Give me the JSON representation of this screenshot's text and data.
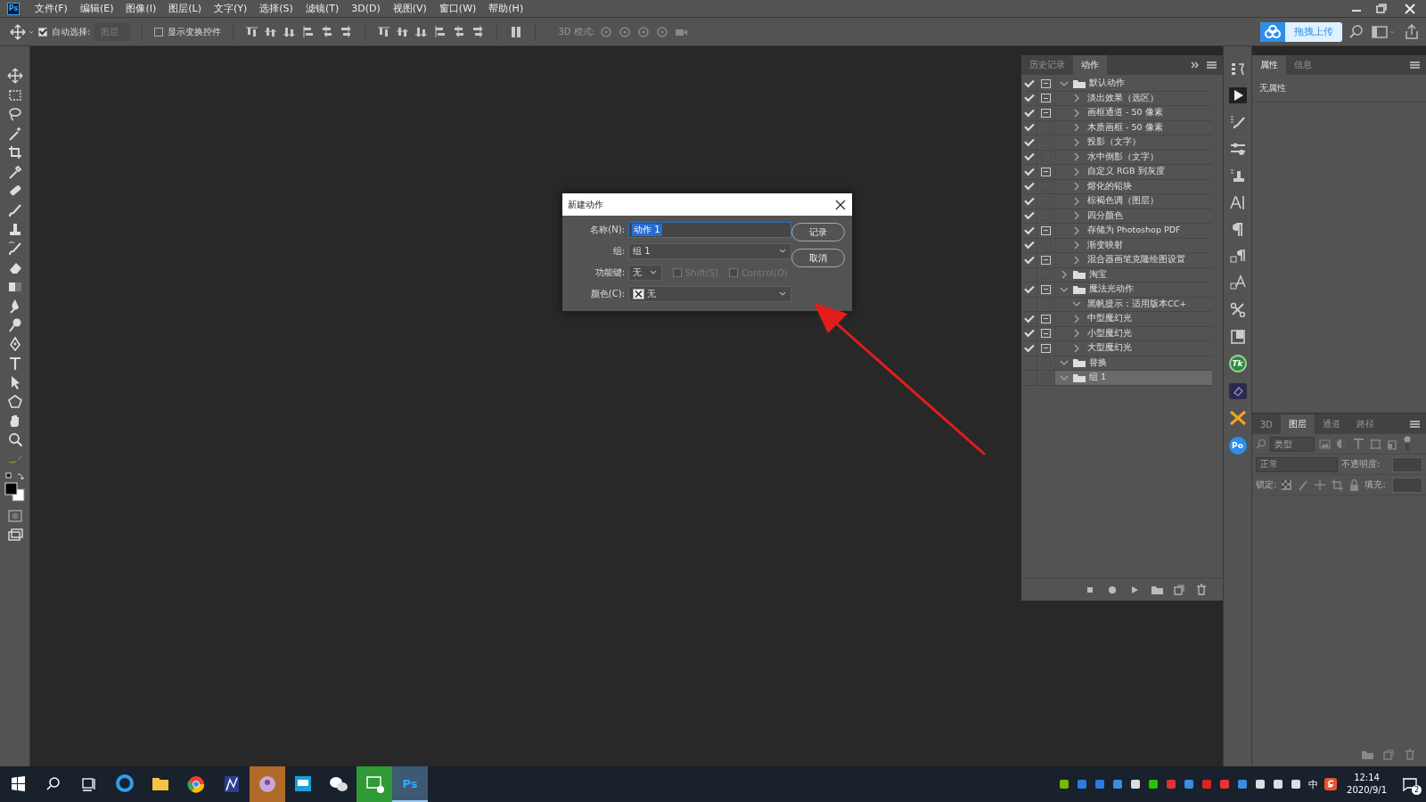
{
  "app_icon": "Ps",
  "menu_bar": {
    "items": [
      "文件(F)",
      "编辑(E)",
      "图像(I)",
      "图层(L)",
      "文字(Y)",
      "选择(S)",
      "滤镜(T)",
      "3D(D)",
      "视图(V)",
      "窗口(W)",
      "帮助(H)"
    ]
  },
  "options_bar": {
    "auto_select": {
      "label": "自动选择:",
      "checked": true
    },
    "auto_select_target": {
      "value": "图层",
      "disabled": true
    },
    "show_transform": {
      "label": "显示变换控件",
      "checked": false
    },
    "mode_label": "3D 模式:"
  },
  "upload_button": "拖拽上传",
  "actions_panel": {
    "tabs": [
      {
        "label": "历史记录",
        "selected": false
      },
      {
        "label": "动作",
        "selected": true
      }
    ],
    "items": [
      {
        "kind": "set",
        "name": "默认动作",
        "checked": true,
        "dialog": true,
        "expanded": true,
        "selected": false,
        "children": [
          {
            "kind": "action",
            "name": "淡出效果（选区）",
            "checked": true,
            "dialog": true,
            "expanded": false,
            "selected": false
          },
          {
            "kind": "action",
            "name": "画框通道 - 50 像素",
            "checked": true,
            "dialog": true,
            "expanded": false,
            "selected": false
          },
          {
            "kind": "action",
            "name": "木质画框 - 50 像素",
            "checked": true,
            "dialog": false,
            "expanded": false,
            "selected": false
          },
          {
            "kind": "action",
            "name": "投影（文字）",
            "checked": true,
            "dialog": false,
            "expanded": false,
            "selected": false
          },
          {
            "kind": "action",
            "name": "水中倒影（文字）",
            "checked": true,
            "dialog": false,
            "expanded": false,
            "selected": false
          },
          {
            "kind": "action",
            "name": "自定义 RGB 到灰度",
            "checked": true,
            "dialog": true,
            "expanded": false,
            "selected": false
          },
          {
            "kind": "action",
            "name": "熔化的铅块",
            "checked": true,
            "dialog": false,
            "expanded": false,
            "selected": false
          },
          {
            "kind": "action",
            "name": "棕褐色调（图层）",
            "checked": true,
            "dialog": false,
            "expanded": false,
            "selected": false
          },
          {
            "kind": "action",
            "name": "四分颜色",
            "checked": true,
            "dialog": false,
            "expanded": false,
            "selected": false
          },
          {
            "kind": "action",
            "name": "存储为 Photoshop PDF",
            "checked": true,
            "dialog": true,
            "expanded": false,
            "selected": false
          },
          {
            "kind": "action",
            "name": "渐变映射",
            "checked": true,
            "dialog": false,
            "expanded": false,
            "selected": false
          },
          {
            "kind": "action",
            "name": "混合器画笔克隆绘图设置",
            "checked": true,
            "dialog": true,
            "expanded": false,
            "selected": false
          }
        ]
      },
      {
        "kind": "set",
        "name": "淘宝",
        "checked": false,
        "dialog": false,
        "expanded": false,
        "selected": false
      },
      {
        "kind": "set",
        "name": "魔法光动作",
        "checked": true,
        "dialog": true,
        "expanded": true,
        "selected": false,
        "children": [
          {
            "kind": "action",
            "name": "黑帆提示：适用版本CC+",
            "checked": false,
            "dialog": false,
            "expanded": true,
            "selected": false
          },
          {
            "kind": "action",
            "name": "中型魔幻光",
            "checked": true,
            "dialog": true,
            "expanded": false,
            "selected": false
          },
          {
            "kind": "action",
            "name": "小型魔幻光",
            "checked": true,
            "dialog": true,
            "expanded": false,
            "selected": false
          },
          {
            "kind": "action",
            "name": "大型魔幻光",
            "checked": true,
            "dialog": true,
            "expanded": false,
            "selected": false
          }
        ]
      },
      {
        "kind": "set",
        "name": "替换",
        "checked": false,
        "dialog": false,
        "expanded": true,
        "selected": false
      },
      {
        "kind": "set",
        "name": "组 1",
        "checked": false,
        "dialog": false,
        "expanded": true,
        "selected": true
      }
    ]
  },
  "plugin_badges": [
    "Tk",
    "Po"
  ],
  "properties_panel": {
    "tabs": [
      {
        "label": "属性",
        "selected": true
      },
      {
        "label": "信息",
        "selected": false
      }
    ],
    "message": "无属性"
  },
  "layers_panel": {
    "tabs": [
      {
        "label": "3D",
        "selected": false
      },
      {
        "label": "图层",
        "selected": true
      },
      {
        "label": "通道",
        "selected": false
      },
      {
        "label": "路径",
        "selected": false
      }
    ],
    "filter_placeholder": "类型",
    "blend_mode": "正常",
    "opacity_label": "不透明度:",
    "lock_label": "锁定:",
    "fill_label": "填充:"
  },
  "dialog": {
    "title": "新建动作",
    "fields": [
      {
        "kind": "text",
        "label": "名称(N):",
        "value": "动作 1",
        "selected": true
      },
      {
        "kind": "select",
        "label": "组:",
        "value": "组 1"
      },
      {
        "kind": "fkey",
        "label": "功能键:",
        "value": "无"
      },
      {
        "kind": "color",
        "label": "颜色(C):",
        "value": "无"
      }
    ],
    "modifiers": [
      {
        "label": "Shift(S)",
        "checked": false,
        "disabled": true
      },
      {
        "label": "Control(O)",
        "checked": false,
        "disabled": true
      }
    ],
    "buttons": [
      "记录",
      "取消"
    ]
  },
  "taskbar": {
    "ps_label": "Ps",
    "ime": "中",
    "time": "12:14",
    "date": "2020/9/1",
    "notifications": "2"
  }
}
